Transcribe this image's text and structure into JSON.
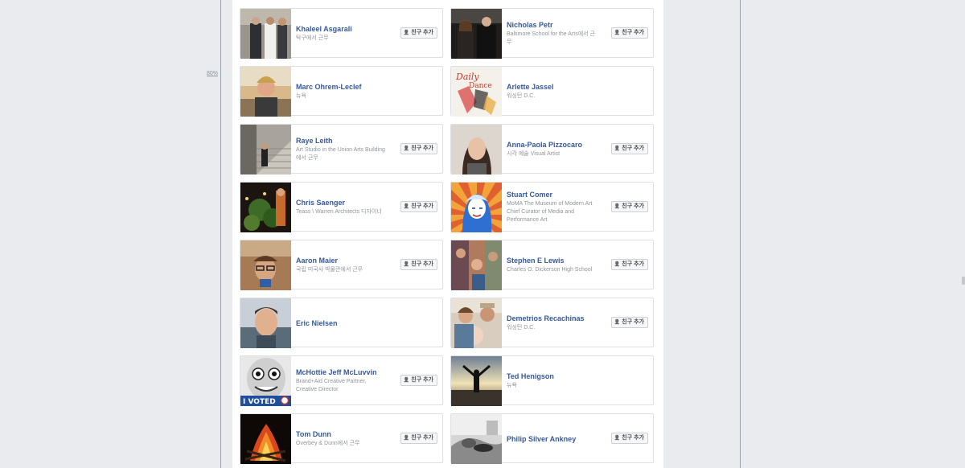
{
  "zoom_label": "80%",
  "add_friend_label": "친구 추가",
  "colors": {
    "name_link": "#365899",
    "subtext": "#90949c",
    "border": "#dddfe2"
  },
  "people": [
    {
      "name": "Khaleel Asgarali",
      "sub": "탁구에서 근무",
      "has_add": true,
      "thumb": "photo-two-men-suits"
    },
    {
      "name": "Nicholas Petr",
      "sub": "Baltimore School for the Arts에서 근무",
      "has_add": true,
      "thumb": "photo-couple-dark"
    },
    {
      "name": "Marc Ohrem-Leclef",
      "sub": "뉴욕",
      "has_add": false,
      "thumb": "photo-man-outdoors"
    },
    {
      "name": "Arlette Jassel",
      "sub": "워싱턴 D.C.",
      "has_add": false,
      "thumb": "illustration-dance"
    },
    {
      "name": "Raye Leith",
      "sub": "Art Studio in the Union Arts Building에서 근무",
      "has_add": true,
      "thumb": "photo-stairs"
    },
    {
      "name": "Anna-Paola Pizzocaro",
      "sub": "시각 예술 Visual Artist",
      "has_add": true,
      "thumb": "photo-woman-portrait"
    },
    {
      "name": "Chris Saenger",
      "sub": "Teass \\ Warren Architects 디자이너",
      "has_add": true,
      "thumb": "photo-night-garden"
    },
    {
      "name": "Stuart Comer",
      "sub": "MoMA The Museum of Modern Art Chief Curator of Media and Performance Art",
      "has_add": true,
      "thumb": "pop-art-portrait"
    },
    {
      "name": "Aaron Maier",
      "sub": "국립 미국사 박물관에서 근무",
      "has_add": true,
      "thumb": "photo-man-glasses"
    },
    {
      "name": "Stephen E Lewis",
      "sub": "Charles O. Dickerson High School",
      "has_add": true,
      "thumb": "photo-colorful-collage"
    },
    {
      "name": "Eric Nielsen",
      "sub": "",
      "has_add": false,
      "thumb": "photo-man-selfie"
    },
    {
      "name": "Demetrios Recachinas",
      "sub": "워싱턴 D.C.",
      "has_add": true,
      "thumb": "photo-family-baby"
    },
    {
      "name": "McHottie Jeff McLuvvin",
      "sub": "Brand+Aid Creative Partner, Creative Director",
      "has_add": true,
      "thumb": "i-voted-face",
      "thumb_text": "I VOTED"
    },
    {
      "name": "Ted Henigson",
      "sub": "뉴욕",
      "has_add": false,
      "thumb": "photo-sunset-arms"
    },
    {
      "name": "Tom Dunn",
      "sub": "Overbey & Dunn에서 근무",
      "has_add": true,
      "thumb": "photo-campfire"
    },
    {
      "name": "Philip Silver Ankney",
      "sub": "",
      "has_add": true,
      "thumb": "photo-bw-sleeping"
    }
  ]
}
